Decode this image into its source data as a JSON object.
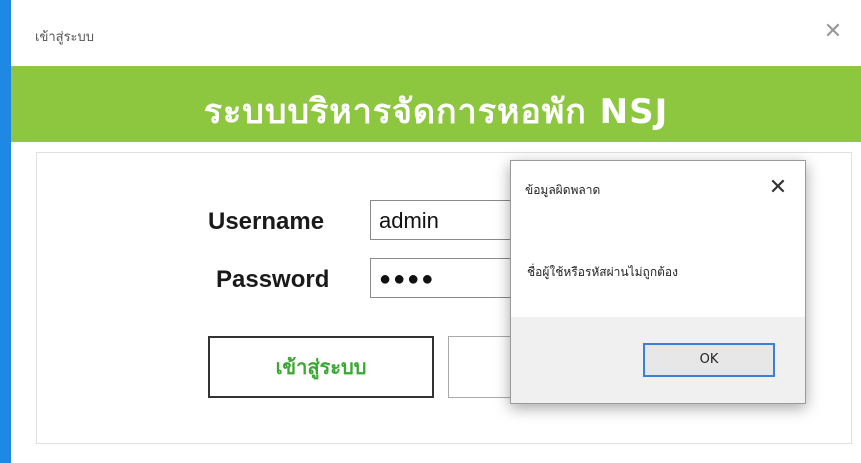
{
  "window": {
    "title": "เข้าสู่ระบบ",
    "close_glyph": "✕",
    "accent_color": "#1e88e5"
  },
  "banner": {
    "title": "ระบบบริหารจัดการหอพัก NSJ",
    "bg_color": "#8dc63f"
  },
  "form": {
    "username_label": "Username",
    "username_value": "admin",
    "password_label": "Password",
    "password_value": "●●●●",
    "login_button": "เข้าสู่ระบบ",
    "cancel_button": ""
  },
  "dialog": {
    "title": "ข้อมูลผิดพลาด",
    "close_glyph": "✕",
    "message": "ชื่อผู้ใช้หรือรหัสผ่านไม่ถูกต้อง",
    "ok_button": "OK"
  }
}
